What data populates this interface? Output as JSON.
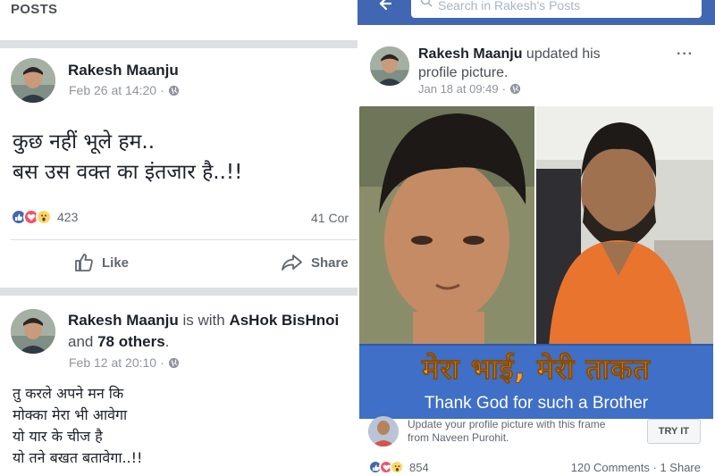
{
  "left_panel": {
    "header_title": "POSTS",
    "post1": {
      "author": "Rakesh Maanju",
      "meta_date": "Feb 26 at 14:20",
      "meta_sep": "·",
      "text_line1": "कुछ नहीं भूले हम..",
      "text_line2": "बस उस वक्त का इंतजार है..!!",
      "reaction_count": "423",
      "comments_count": "41 Cor",
      "like_label": "Like",
      "share_label": "Share"
    },
    "post2": {
      "author": "Rakesh Maanju",
      "with_word": " is with ",
      "tagged_person": "AsHok BisHnoi",
      "and_word": " and ",
      "others": "78 others",
      "period": ".",
      "meta_date": "Feb 12 at 20:10",
      "meta_sep": "·",
      "text_lines": [
        "तु करले अपने मन कि",
        "मोक्का मेरा भी आवेगा",
        "यो यार के चीज है",
        "यो तने बखत बतावेगा..!!"
      ]
    }
  },
  "right_panel": {
    "search_placeholder": "Search in Rakesh's Posts",
    "post": {
      "author": "Rakesh Maanju",
      "action_text": " updated his profile picture.",
      "meta_date": "Jan 18 at 09:49",
      "meta_sep": "·",
      "more_label": "···",
      "banner_hindi": "मेरा भाई, मेरी ताकत",
      "banner_english": "Thank God for such a Brother",
      "promo_line1": "Update your profile picture with this frame",
      "promo_line2": "from Naveen Purohit.",
      "try_it_label": "TRY IT",
      "reaction_count": "854",
      "comments_label": "120 Comments",
      "shares_sep": " · ",
      "shares_label": "1 Share"
    }
  },
  "colors": {
    "facebook_blue": "#4267b2",
    "separator_gray": "#dddfe2",
    "meta_gray": "#90949c",
    "banner_blue": "#3f6fc6",
    "banner_orange": "#f3a33a"
  },
  "icons": {
    "globe": "globe-icon",
    "like": "thumbs-up-icon",
    "share": "share-arrow-icon",
    "search": "search-icon",
    "back": "back-arrow-icon"
  }
}
